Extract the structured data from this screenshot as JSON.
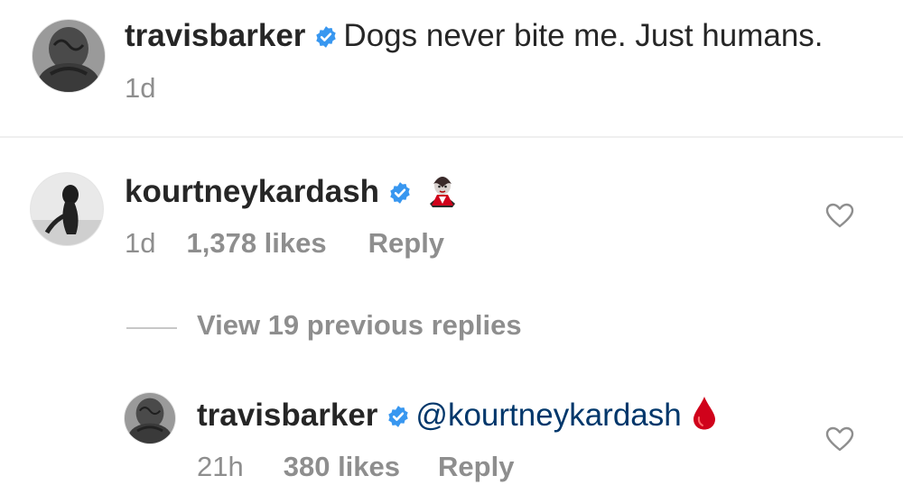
{
  "caption": {
    "username": "travisbarker",
    "text": "Dogs never bite me. Just humans.",
    "time": "1d"
  },
  "comment": {
    "username": "kourtneykardash",
    "emoji_icon": "vampire-emoji",
    "time": "1d",
    "likes": "1,378 likes",
    "reply_label": "Reply"
  },
  "view_replies": "View 19 previous replies",
  "reply": {
    "username": "travisbarker",
    "mention": "@kourtneykardash",
    "emoji_icon": "blood-drop-emoji",
    "time": "21h",
    "likes": "380 likes",
    "reply_label": "Reply"
  },
  "colors": {
    "verified": "#3897f0",
    "meta_text": "#8e8e8e",
    "mention": "#00376b",
    "blood_drop": "#d0021b"
  }
}
